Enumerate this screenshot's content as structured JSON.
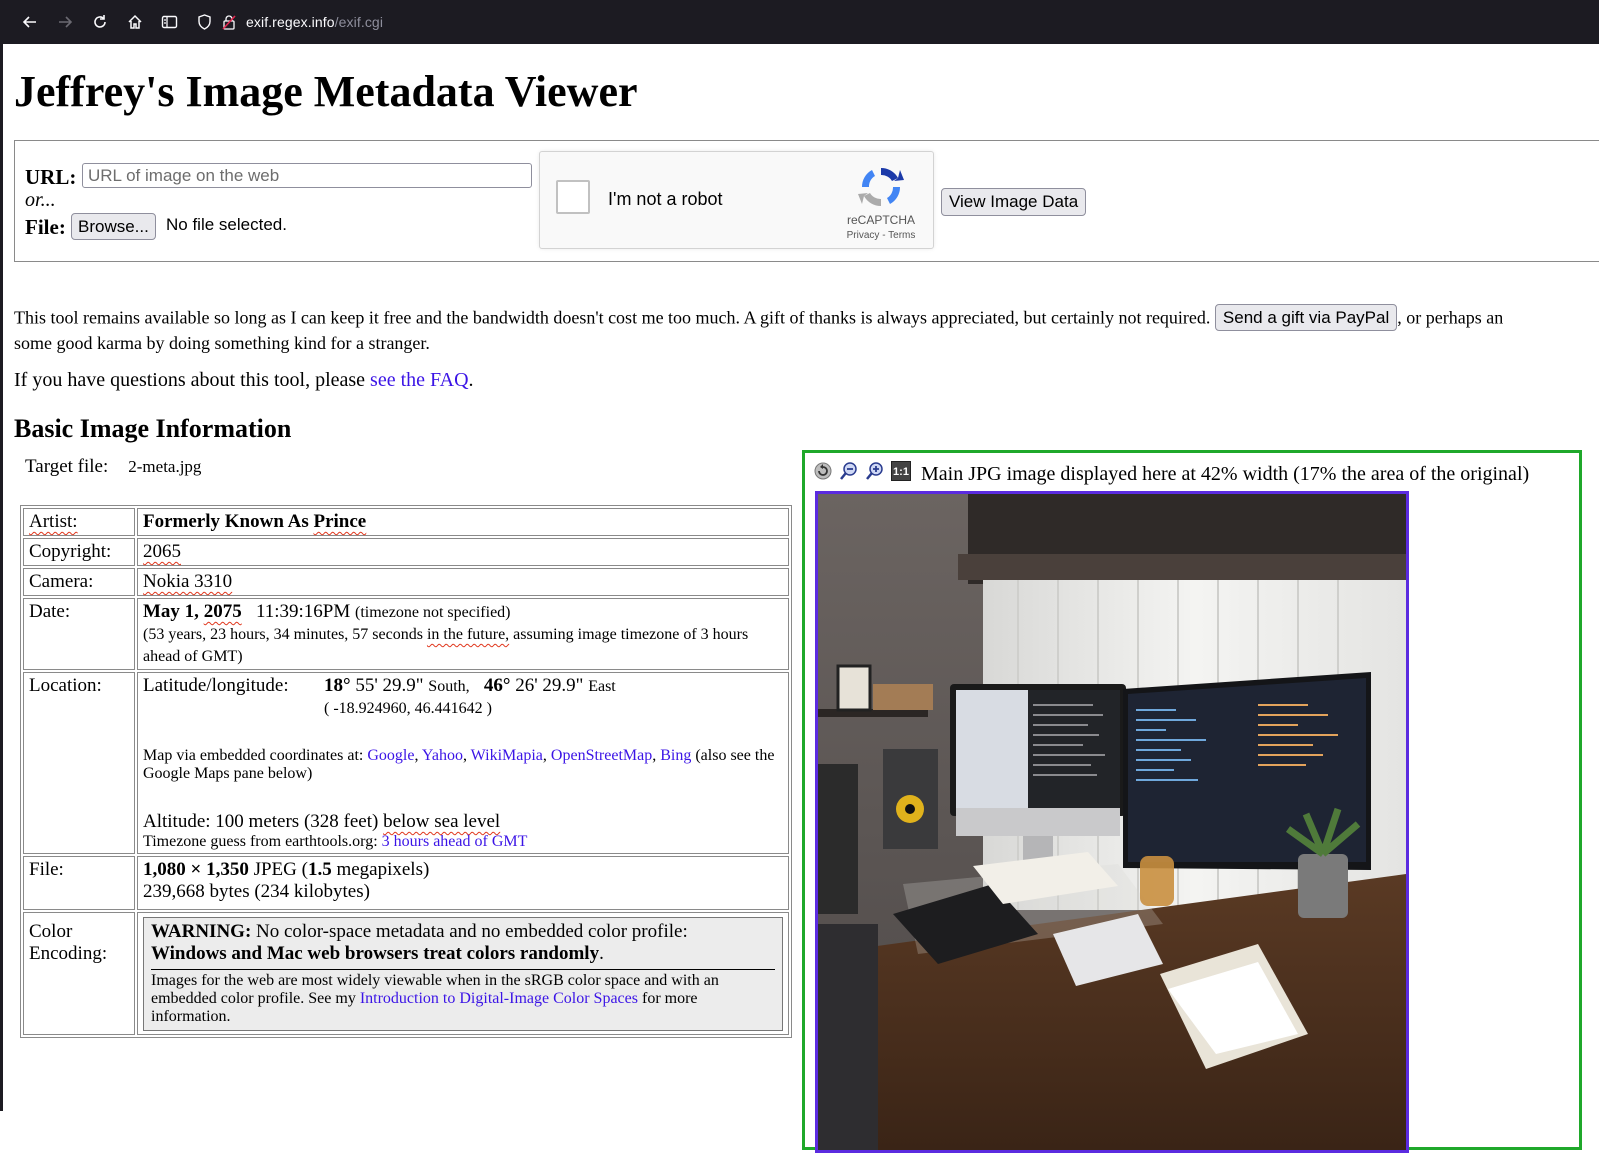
{
  "browser": {
    "url_host": "exif.regex.info",
    "url_path": "/exif.cgi"
  },
  "page": {
    "title": "Jeffrey's Image Metadata Viewer"
  },
  "form": {
    "url_label": "URL:",
    "url_placeholder": "URL of image on the web",
    "or_text": "or...",
    "file_label": "File:",
    "browse_label": "Browse...",
    "no_file_text": "No file selected.",
    "captcha_text": "I'm not a robot",
    "captcha_brand": "reCAPTCHA",
    "captcha_privacy": "Privacy",
    "captcha_sep": " - ",
    "captcha_terms": "Terms",
    "submit_label": "View Image Data"
  },
  "notice": {
    "text_before": "This tool remains available so long as I can keep it free and the bandwidth doesn't cost me too much. A gift of thanks is always appreciated, but certainly not required. ",
    "paypal_label": "Send a gift via PayPal",
    "text_after": ", or perhaps an",
    "line2": "some good karma by doing something kind for a stranger."
  },
  "faq": {
    "before": "If you have questions about this tool, please ",
    "link": "see the FAQ",
    "after": "."
  },
  "basic": {
    "heading": "Basic Image Information",
    "target_label": "Target file:",
    "target_value": "2-meta.jpg",
    "artist_label": "Artist:",
    "artist_value_a": "Formerly Known As",
    "artist_value_b": "Prince",
    "copyright_label": "Copyright:",
    "copyright_value": "2065",
    "camera_label": "Camera:",
    "camera_value": "Nokia 3310",
    "date_label": "Date:",
    "date_main_a": "May 1, ",
    "date_main_b": "2075",
    "date_time": "11:39:16PM",
    "date_tz": "(timezone not specified)",
    "date_note_a": "(53 years, 23 hours, 34 minutes, 57 seconds ",
    "date_note_b": "in the future,",
    "date_note_c": " assuming image timezone of 3 hours ahead of GMT)",
    "location_label": "Location:",
    "latlon_label": "Latitude/longitude:",
    "lat_deg": "18°",
    "lat_rest": " 55' 29.9\"",
    "lat_dir": "South,",
    "lon_deg": "46°",
    "lon_rest": " 26' 29.9\"",
    "lon_dir": "East",
    "decimal": "( -18.924960, 46.441642 )",
    "map_text": "Map via embedded coordinates at: ",
    "map_links": [
      "Google",
      "Yahoo",
      "WikiMapia",
      "OpenStreetMap",
      "Bing"
    ],
    "map_after": " (also see the Google Maps pane below)",
    "altitude_a": "Altitude: 100 meters (328 feet) ",
    "altitude_b": "below sea level",
    "tz_guess": "Timezone guess from earthtools.org: ",
    "tz_link": "3 hours ahead of GMT",
    "file_label": "File:",
    "file_dims": "1,080 × 1,350",
    "file_type_a": " JPEG (",
    "file_mp": "1.5",
    "file_type_b": " megapixels)",
    "file_bytes": "239,668 bytes (234 kilobytes)",
    "color_label": "Color Encoding:",
    "warn_head": "WARNING:",
    "warn_text": " No color-space metadata and no embedded color profile:",
    "warn_bold": "Windows and Mac web browsers treat colors randomly",
    "warn_info_a": "Images for the web are most widely viewable when in the sRGB color space and with an embedded color profile. See my ",
    "warn_link": "Introduction to Digital-Image Color Spaces",
    "warn_info_b": " for more information."
  },
  "image_pane": {
    "caption": "Main JPG image displayed here at 42% width (17% the area of the original)",
    "zoom_11": "1:1"
  }
}
